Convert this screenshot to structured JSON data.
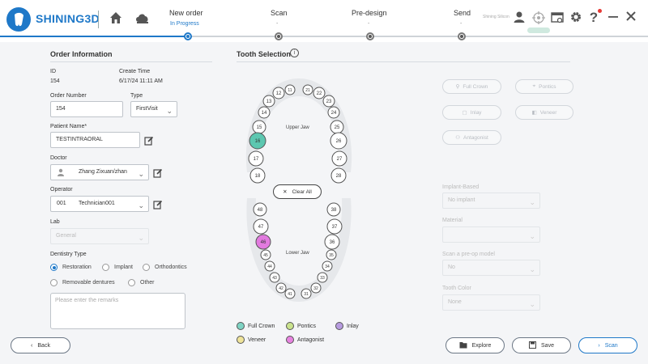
{
  "header": {
    "brand": "SHINING3D",
    "user_text": "Shining Silicon",
    "steps": [
      {
        "label": "New order",
        "sub": "In Progress"
      },
      {
        "label": "Scan",
        "sub": "-"
      },
      {
        "label": "Pre-design",
        "sub": "-"
      },
      {
        "label": "Send",
        "sub": "-"
      }
    ]
  },
  "order": {
    "section_title": "Order Information",
    "id_label": "ID",
    "id_value": "154",
    "create_label": "Create Time",
    "create_value": "6/17/24 11:11 AM",
    "order_number_label": "Order Number",
    "order_number_value": "154",
    "type_label": "Type",
    "type_value": "FirstVisit",
    "patient_label": "Patient Name*",
    "patient_value": "TESTINTRAORAL",
    "doctor_label": "Doctor",
    "doctor_value": "Zhang Zixuan/zhan",
    "operator_label": "Operator",
    "operator_code": "001",
    "operator_value": "Technician001",
    "lab_label": "Lab",
    "lab_value": "General",
    "dentistry_label": "Dentistry Type",
    "dentistry_options": [
      "Restoration",
      "Implant",
      "Orthodontics",
      "Removable dentures",
      "Other"
    ],
    "remarks_placeholder": "Please enter the remarks"
  },
  "tooth": {
    "section_title": "Tooth Selection",
    "upper_label": "Upper Jaw",
    "lower_label": "Lower Jaw",
    "clear_all": "Clear All",
    "upper_teeth": [
      "11",
      "12",
      "13",
      "14",
      "15",
      "16",
      "17",
      "18",
      "21",
      "22",
      "23",
      "24",
      "25",
      "26",
      "27",
      "28"
    ],
    "lower_teeth": [
      "31",
      "32",
      "33",
      "34",
      "35",
      "36",
      "37",
      "38",
      "41",
      "42",
      "43",
      "44",
      "45",
      "46",
      "47",
      "48"
    ],
    "selected": [
      {
        "tooth": "16",
        "type": "Full Crown",
        "color": "#5cc7b0"
      },
      {
        "tooth": "46",
        "type": "Antagonist",
        "color": "#e27adf"
      }
    ]
  },
  "restoration_types": [
    "Full Crown",
    "Pontics",
    "Inlay",
    "Veneer",
    "Antagonist"
  ],
  "right_form": {
    "implant_label": "Implant-Based",
    "implant_value": "No implant",
    "material_label": "Material",
    "material_value": "",
    "preop_label": "Scan a pre-op model",
    "preop_value": "No",
    "color_label": "Tooth Color",
    "color_value": "None"
  },
  "legend": [
    {
      "label": "Full Crown",
      "color": "#7ed3c3"
    },
    {
      "label": "Pontics",
      "color": "#c9e28d"
    },
    {
      "label": "Inlay",
      "color": "#b79be0"
    },
    {
      "label": "Veneer",
      "color": "#efe49a"
    },
    {
      "label": "Antagonist",
      "color": "#e783e0"
    }
  ],
  "footer": {
    "back": "Back",
    "explore": "Explore",
    "save": "Save",
    "scan": "Scan"
  },
  "colors": {
    "accent": "#1e78c8"
  }
}
